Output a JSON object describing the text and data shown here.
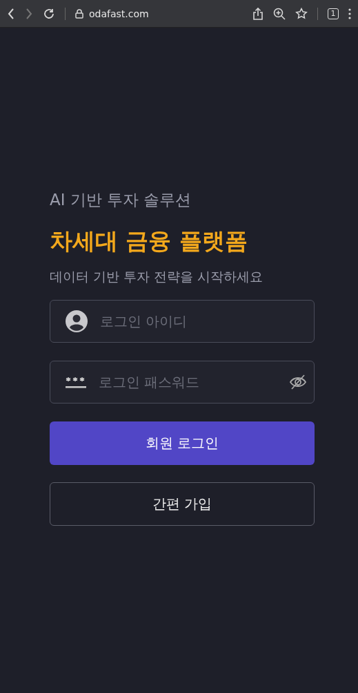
{
  "browser": {
    "url": "odafast.com",
    "tab_count": "1"
  },
  "hero": {
    "eyebrow": "AI 기반 투자 솔루션",
    "title": "차세대 금융 플랫폼",
    "subtitle": "데이터 기반 투자 전략을 시작하세요"
  },
  "form": {
    "fields": [
      {
        "kind": "user",
        "placeholder": "로그인 아이디"
      },
      {
        "kind": "password",
        "placeholder": "로그인 패스워드"
      }
    ],
    "buttons": [
      {
        "kind": "primary",
        "label": "회원 로그인"
      },
      {
        "kind": "outline",
        "label": "간편 가입"
      }
    ]
  }
}
